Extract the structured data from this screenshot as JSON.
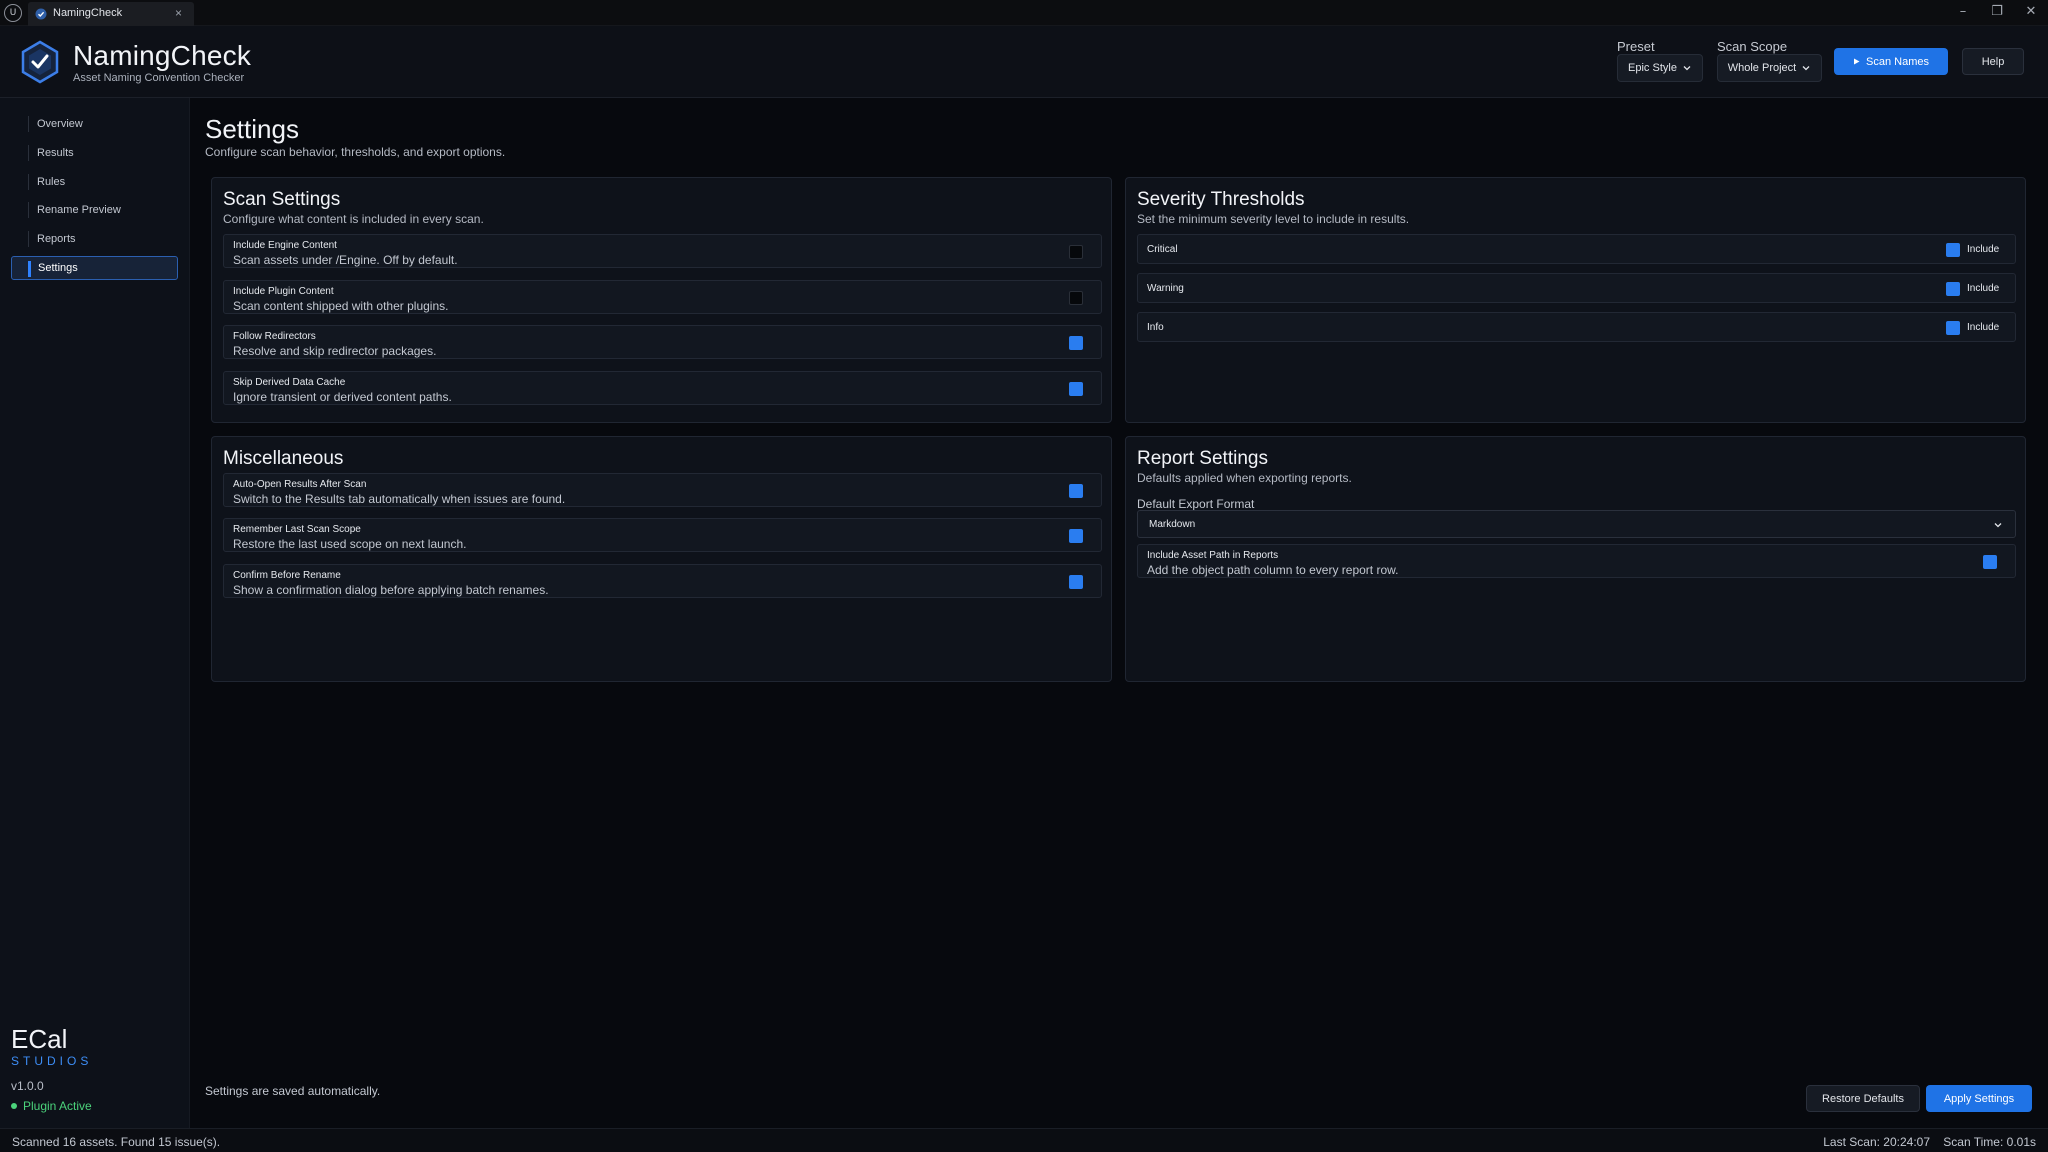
{
  "window": {
    "engine_logo_text": "U",
    "tab_label": "NamingCheck",
    "tab_close": "×",
    "minimize": "–",
    "restore": "❐",
    "close": "✕"
  },
  "header": {
    "title": "NamingCheck",
    "subtitle": "Asset Naming Convention Checker",
    "preset_label": "Preset",
    "preset_value": "Epic Style",
    "scope_label": "Scan Scope",
    "scope_value": "Whole Project",
    "scan_button": "Scan Names",
    "help_button": "Help"
  },
  "sidebar": {
    "items": [
      {
        "label": "Overview"
      },
      {
        "label": "Results"
      },
      {
        "label": "Rules"
      },
      {
        "label": "Rename Preview"
      },
      {
        "label": "Reports"
      },
      {
        "label": "Settings",
        "active": true
      }
    ],
    "brand_name": "ECal",
    "brand_sub": "STUDIOS",
    "version": "v1.0.0",
    "plugin_status": "Plugin Active"
  },
  "page": {
    "title": "Settings",
    "subtitle": "Configure scan behavior, thresholds, and export options."
  },
  "scan_settings": {
    "title": "Scan Settings",
    "subtitle": "Configure what content is included in every scan.",
    "rows": [
      {
        "label": "Include Engine Content",
        "desc": "Scan assets under /Engine. Off by default.",
        "checked": false
      },
      {
        "label": "Include Plugin Content",
        "desc": "Scan content shipped with other plugins.",
        "checked": false
      },
      {
        "label": "Follow Redirectors",
        "desc": "Resolve and skip redirector packages.",
        "checked": true
      },
      {
        "label": "Skip Derived Data Cache",
        "desc": "Ignore transient or derived content paths.",
        "checked": true
      }
    ]
  },
  "severity": {
    "title": "Severity Thresholds",
    "subtitle": "Set the minimum severity level to include in results.",
    "rows": [
      {
        "label": "Critical",
        "include_label": "Include",
        "checked": true
      },
      {
        "label": "Warning",
        "include_label": "Include",
        "checked": true
      },
      {
        "label": "Info",
        "include_label": "Include",
        "checked": true
      }
    ]
  },
  "misc": {
    "title": "Miscellaneous",
    "rows": [
      {
        "label": "Auto-Open Results After Scan",
        "desc": "Switch to the Results tab automatically when issues are found.",
        "checked": true
      },
      {
        "label": "Remember Last Scan Scope",
        "desc": "Restore the last used scope on next launch.",
        "checked": true
      },
      {
        "label": "Confirm Before Rename",
        "desc": "Show a confirmation dialog before applying batch renames.",
        "checked": true
      }
    ]
  },
  "report": {
    "title": "Report Settings",
    "subtitle": "Defaults applied when exporting reports.",
    "export_label": "Default Export Format",
    "export_value": "Markdown",
    "rows": [
      {
        "label": "Include Asset Path in Reports",
        "desc": "Add the object path column to every report row.",
        "checked": true
      }
    ]
  },
  "footer": {
    "autosave_note": "Settings are saved automatically.",
    "restore_button": "Restore Defaults",
    "apply_button": "Apply Settings"
  },
  "statusbar": {
    "left": "Scanned 16 assets. Found 15 issue(s).",
    "last_scan": "Last Scan: 20:24:07",
    "scan_time": "Scan Time: 0.01s"
  },
  "colors": {
    "accent": "#1f73e6",
    "checkbox_on": "#2a7df0",
    "status_ok": "#4bd37b",
    "brand_sub": "#3d8df5"
  }
}
